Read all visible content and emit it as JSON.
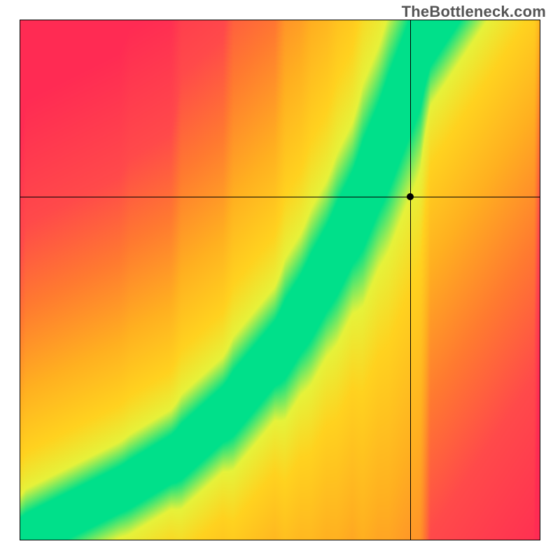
{
  "watermark": "TheBottleneck.com",
  "chart_data": {
    "type": "heatmap",
    "title": "",
    "xlabel": "",
    "ylabel": "",
    "xlim": [
      0,
      1
    ],
    "ylim": [
      0,
      1
    ],
    "crosshair": {
      "x": 0.75,
      "y": 0.66
    },
    "marker": {
      "x": 0.75,
      "y": 0.66
    },
    "green_curve": {
      "description": "Superlinear optimal band: y ≈ 0.7·x^1.6 + 0.8·x^3 (rough read-off), plotted from bottom-left to top-right",
      "points_sampled": [
        {
          "x": 0.0,
          "y": 0.0
        },
        {
          "x": 0.1,
          "y": 0.05
        },
        {
          "x": 0.2,
          "y": 0.1
        },
        {
          "x": 0.3,
          "y": 0.16
        },
        {
          "x": 0.4,
          "y": 0.25
        },
        {
          "x": 0.5,
          "y": 0.37
        },
        {
          "x": 0.55,
          "y": 0.45
        },
        {
          "x": 0.6,
          "y": 0.54
        },
        {
          "x": 0.65,
          "y": 0.64
        },
        {
          "x": 0.7,
          "y": 0.76
        },
        {
          "x": 0.75,
          "y": 0.89
        },
        {
          "x": 0.78,
          "y": 0.97
        },
        {
          "x": 0.8,
          "y": 1.0
        }
      ],
      "band_halfwidth": 0.04
    },
    "colorscale": [
      {
        "dist": 0.0,
        "color": "#00e08a"
      },
      {
        "dist": 0.06,
        "color": "#e6f23a"
      },
      {
        "dist": 0.15,
        "color": "#ffd21f"
      },
      {
        "dist": 0.3,
        "color": "#ffb020"
      },
      {
        "dist": 0.5,
        "color": "#ff7a30"
      },
      {
        "dist": 0.7,
        "color": "#ff4a4a"
      },
      {
        "dist": 1.0,
        "color": "#ff2b53"
      }
    ],
    "resolution": 120
  }
}
